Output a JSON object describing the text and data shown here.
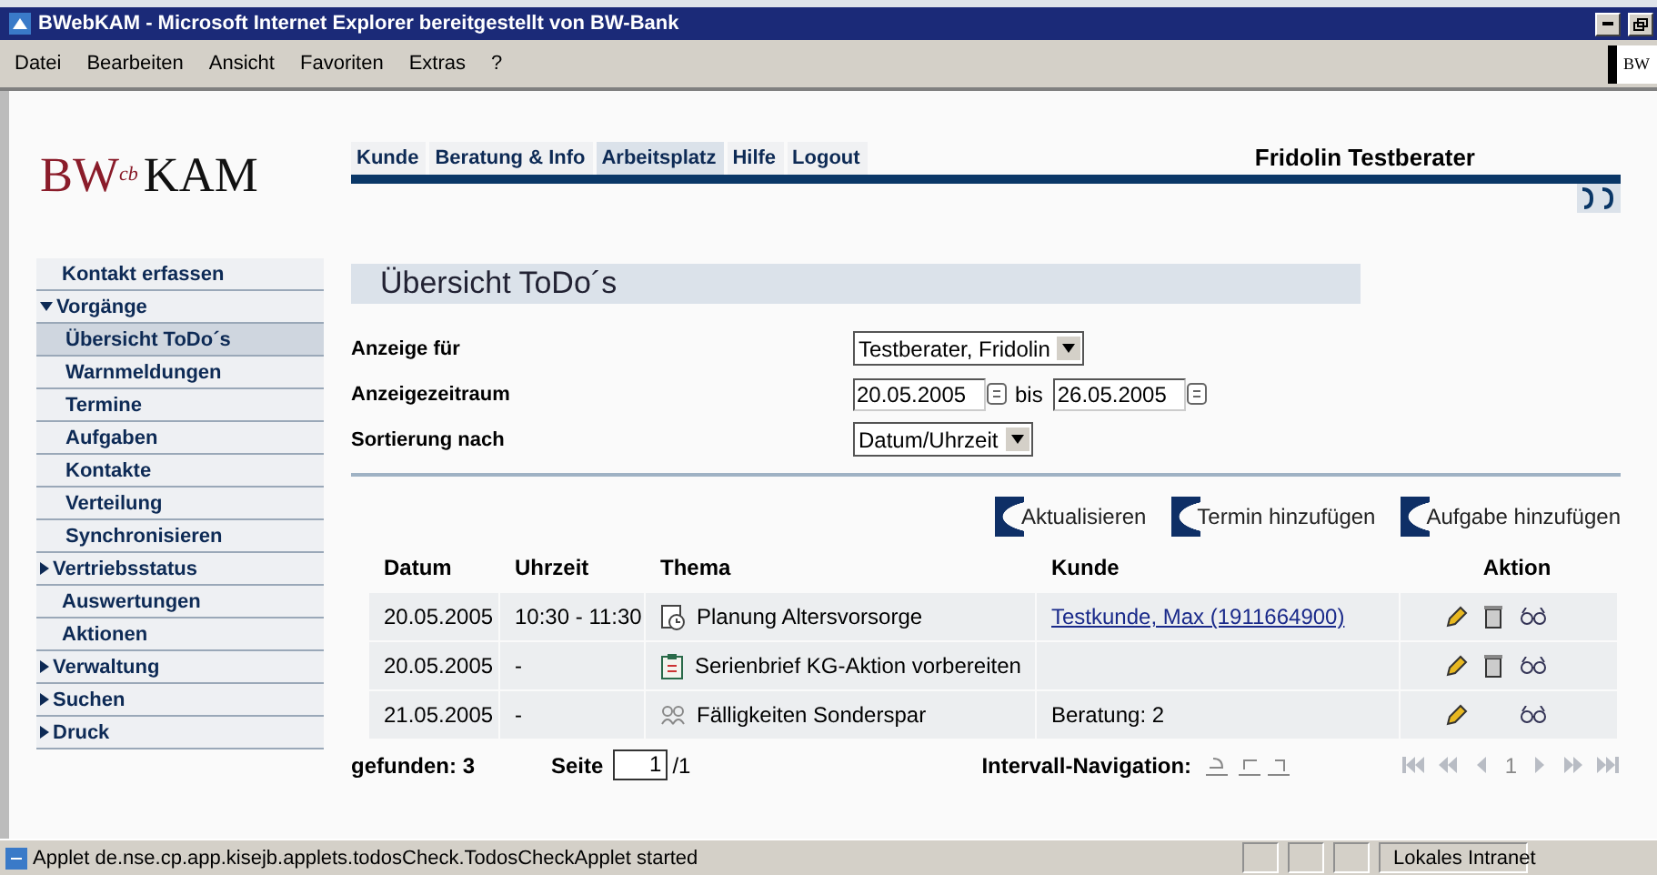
{
  "window": {
    "title": "BWebKAM - Microsoft Internet Explorer bereitgestellt von BW-Bank"
  },
  "menu": [
    "Datei",
    "Bearbeiten",
    "Ansicht",
    "Favoriten",
    "Extras",
    "?"
  ],
  "toolbar_logo": "BW",
  "logo": {
    "main": "BW",
    "sup": "cb",
    "suffix": "KAM"
  },
  "tabs": [
    {
      "label": "Kunde",
      "selected": false
    },
    {
      "label": "Beratung & Info",
      "selected": false
    },
    {
      "label": "Arbeitsplatz",
      "selected": true
    },
    {
      "label": "Hilfe",
      "selected": false
    },
    {
      "label": "Logout",
      "selected": false
    }
  ],
  "user": "Fridolin Testberater",
  "sidebar": {
    "items": [
      {
        "label": "Kontakt erfassen",
        "kind": "link",
        "selected": false
      },
      {
        "label": "Vorgänge",
        "kind": "group",
        "expanded": true,
        "selected": false,
        "children": [
          {
            "label": "Übersicht ToDo´s",
            "selected": true
          },
          {
            "label": "Warnmeldungen",
            "selected": false
          },
          {
            "label": "Termine",
            "selected": false
          },
          {
            "label": "Aufgaben",
            "selected": false
          },
          {
            "label": "Kontakte",
            "selected": false
          },
          {
            "label": "Verteilung",
            "selected": false
          },
          {
            "label": "Synchronisieren",
            "selected": false
          }
        ]
      },
      {
        "label": "Vertriebsstatus",
        "kind": "group",
        "expanded": false,
        "selected": false
      },
      {
        "label": "Auswertungen",
        "kind": "link",
        "selected": false
      },
      {
        "label": "Aktionen",
        "kind": "link",
        "selected": false
      },
      {
        "label": "Verwaltung",
        "kind": "group",
        "expanded": false,
        "selected": false
      },
      {
        "label": "Suchen",
        "kind": "group",
        "expanded": false,
        "selected": false
      },
      {
        "label": "Druck",
        "kind": "group",
        "expanded": false,
        "selected": false
      }
    ]
  },
  "page_title": "Übersicht ToDo´s",
  "filters": [
    {
      "label": "Anzeige für",
      "kind": "select",
      "value": "Testberater, Fridolin"
    },
    {
      "label": "Anzeigezeitraum",
      "kind": "daterange",
      "from": "20.05.2005",
      "separator": "bis",
      "to": "26.05.2005"
    },
    {
      "label": "Sortierung nach",
      "kind": "select",
      "value": "Datum/Uhrzeit"
    }
  ],
  "buttons": [
    "Aktualisieren",
    "Termin hinzufügen",
    "Aufgabe hinzufügen"
  ],
  "table": {
    "columns": [
      "Datum",
      "Uhrzeit",
      "Thema",
      "Kunde",
      "Aktion"
    ],
    "rows": [
      {
        "date": "20.05.2005",
        "time": "10:30 - 11:30",
        "kind": "appointment",
        "topic": "Planung Altersvorsorge",
        "customer_link": "Testkunde, Max (1911664900)",
        "deletable": true
      },
      {
        "date": "20.05.2005",
        "time": "-",
        "kind": "task",
        "topic": "Serienbrief KG-Aktion vorbereiten",
        "deletable": true
      },
      {
        "date": "21.05.2005",
        "time": "-",
        "kind": "consultation",
        "topic": "Fälligkeiten Sonderspar",
        "customer": "Beratung: 2",
        "deletable": false
      }
    ]
  },
  "footer": {
    "found": "gefunden: 3",
    "page_label": "Seite",
    "page_value": "1",
    "page_total": "/1",
    "interval_label": "Intervall-Navigation:",
    "current_page": "1"
  },
  "status_bar": {
    "message": "Applet de.nse.cp.app.kisejb.applets.todosCheck.TodosCheckApplet started",
    "zone": "Lokales Intranet"
  }
}
